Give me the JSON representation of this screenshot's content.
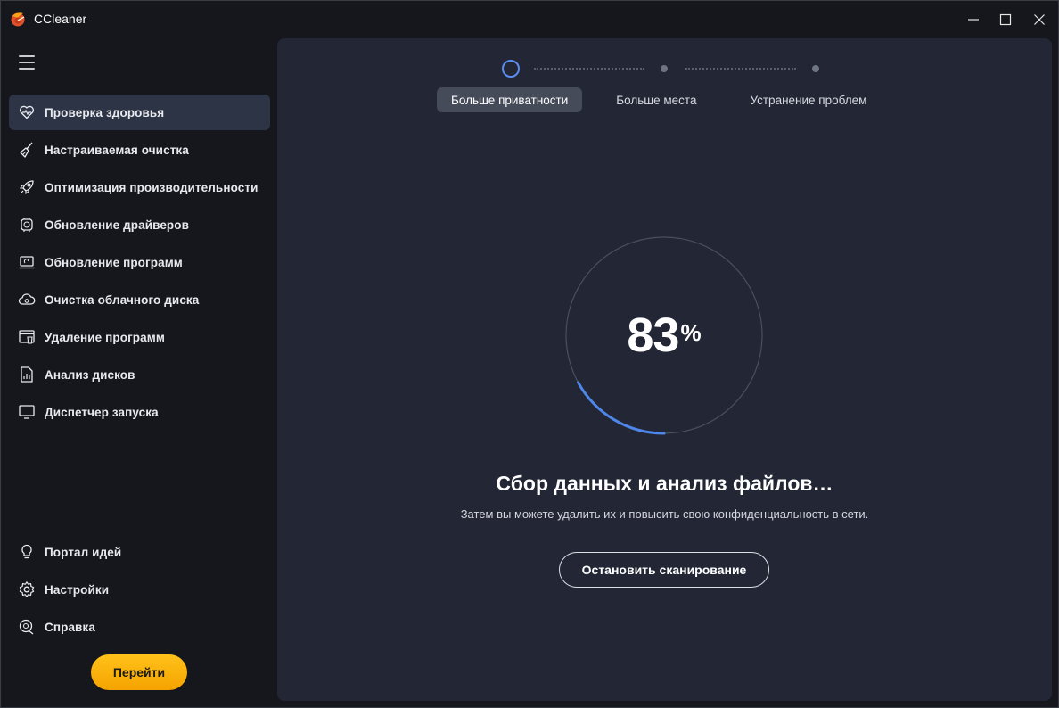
{
  "window": {
    "title": "CCleaner"
  },
  "sidebar": {
    "items": [
      {
        "label": "Проверка здоровья",
        "icon": "heart-icon",
        "active": true
      },
      {
        "label": "Настраиваемая очистка",
        "icon": "broom-icon",
        "active": false
      },
      {
        "label": "Оптимизация производительности",
        "icon": "rocket-icon",
        "active": false
      },
      {
        "label": "Обновление драйверов",
        "icon": "chip-icon",
        "active": false
      },
      {
        "label": "Обновление программ",
        "icon": "software-update-icon",
        "active": false
      },
      {
        "label": "Очистка облачного диска",
        "icon": "cloud-gear-icon",
        "active": false
      },
      {
        "label": "Удаление программ",
        "icon": "uninstall-icon",
        "active": false
      },
      {
        "label": "Анализ дисков",
        "icon": "document-chart-icon",
        "active": false
      },
      {
        "label": "Диспетчер запуска",
        "icon": "monitor-icon",
        "active": false
      }
    ],
    "bottom_items": [
      {
        "label": "Портал идей",
        "icon": "lightbulb-icon"
      },
      {
        "label": "Настройки",
        "icon": "gear-icon"
      },
      {
        "label": "Справка",
        "icon": "help-icon"
      }
    ],
    "go_button": "Перейти"
  },
  "main": {
    "steps": [
      {
        "label": "Больше приватности",
        "active": true
      },
      {
        "label": "Больше места",
        "active": false
      },
      {
        "label": "Устранение проблем",
        "active": false
      }
    ],
    "progress": {
      "value": "83",
      "unit": "%",
      "fraction": 0.17
    },
    "status_title": "Сбор данных и анализ файлов…",
    "status_subtitle": "Затем вы можете удалить их и повысить свою конфиденциальность в сети.",
    "stop_button": "Остановить сканирование"
  },
  "colors": {
    "accent": "#5b8def",
    "go_button": "#ffb30f",
    "panel": "#232735",
    "background": "#15171c"
  }
}
